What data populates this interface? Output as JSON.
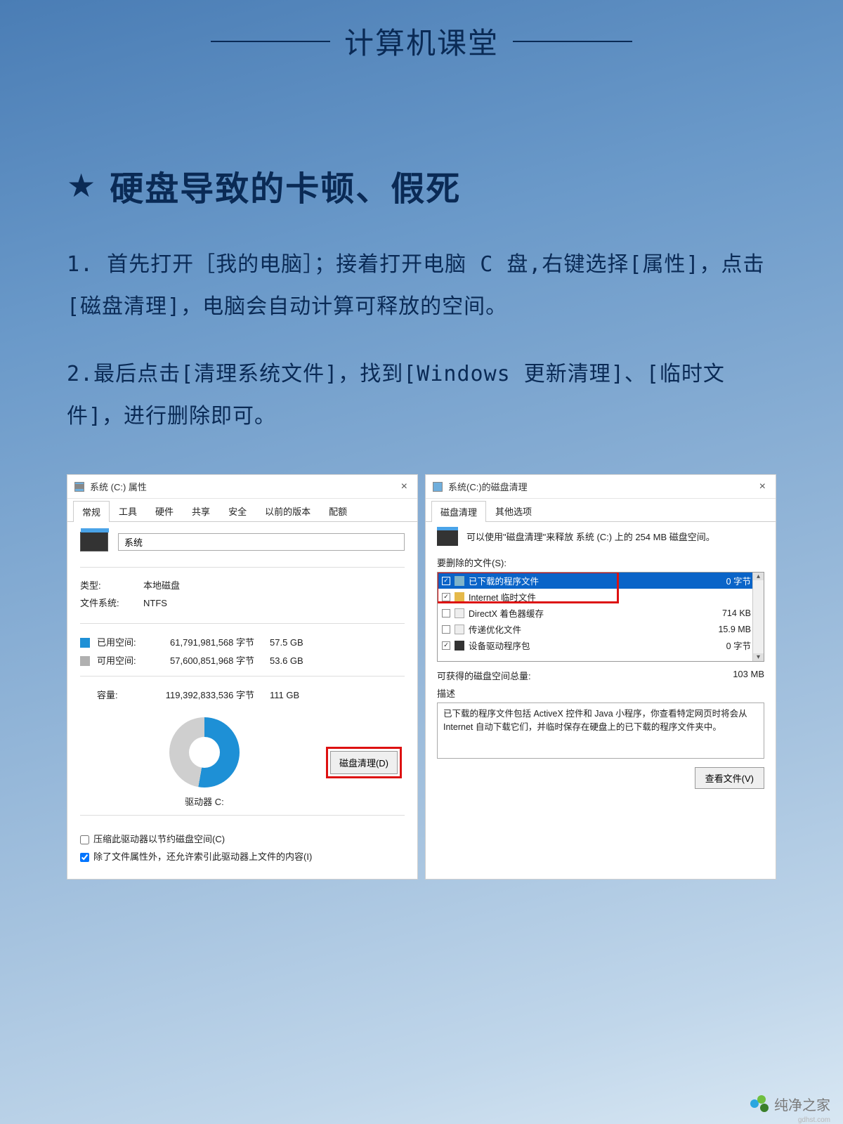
{
  "header": {
    "title": "计算机课堂"
  },
  "article": {
    "heading": "硬盘导致的卡顿、假死",
    "step1": "1. 首先打开［我的电脑］；接着打开电脑 C 盘,右键选择[属性]，点击[磁盘清理]，电脑会自动计算可释放的空间。",
    "step2": "2.最后点击[清理系统文件]，找到[Windows 更新清理]、[临时文件]，进行删除即可。"
  },
  "props": {
    "title": "系统 (C:) 属性",
    "tabs": [
      "常规",
      "工具",
      "硬件",
      "共享",
      "安全",
      "以前的版本",
      "配额"
    ],
    "driveName": "系统",
    "typeLabel": "类型:",
    "typeValue": "本地磁盘",
    "fsLabel": "文件系统:",
    "fsValue": "NTFS",
    "usedLabel": "已用空间:",
    "usedBytes": "61,791,981,568 字节",
    "usedGB": "57.5 GB",
    "freeLabel": "可用空间:",
    "freeBytes": "57,600,851,968 字节",
    "freeGB": "53.6 GB",
    "capLabel": "容量:",
    "capBytes": "119,392,833,536 字节",
    "capGB": "111 GB",
    "driveLabel": "驱动器 C:",
    "cleanupBtn": "磁盘清理(D)",
    "compress": "压缩此驱动器以节约磁盘空间(C)",
    "index": "除了文件属性外，还允许索引此驱动器上文件的内容(I)"
  },
  "cleanup": {
    "title": "系统(C:)的磁盘清理",
    "tabs": [
      "磁盘清理",
      "其他选项"
    ],
    "infoText": "可以使用\"磁盘清理\"来释放 系统 (C:) 上的 254 MB 磁盘空间。",
    "filesLabel": "要删除的文件(S):",
    "items": [
      {
        "checked": true,
        "icon": "app",
        "name": "已下载的程序文件",
        "size": "0 字节",
        "selected": true
      },
      {
        "checked": true,
        "icon": "lock",
        "name": "Internet 临时文件",
        "size": "",
        "selected": false
      },
      {
        "checked": false,
        "icon": "file",
        "name": "DirectX 着色器缓存",
        "size": "714 KB",
        "selected": false
      },
      {
        "checked": false,
        "icon": "file",
        "name": "传递优化文件",
        "size": "15.9 MB",
        "selected": false
      },
      {
        "checked": true,
        "icon": "dev",
        "name": "设备驱动程序包",
        "size": "0 字节",
        "selected": false
      }
    ],
    "totalLabel": "可获得的磁盘空间总量:",
    "totalValue": "103 MB",
    "descLabel": "描述",
    "descText": "已下载的程序文件包括 ActiveX 控件和 Java 小程序，你查看特定网页时将会从 Internet 自动下载它们，并临时保存在硬盘上的已下载的程序文件夹中。",
    "viewBtn": "查看文件(V)"
  },
  "watermark": {
    "brand": "纯净之家",
    "url": "gdhst.com"
  }
}
